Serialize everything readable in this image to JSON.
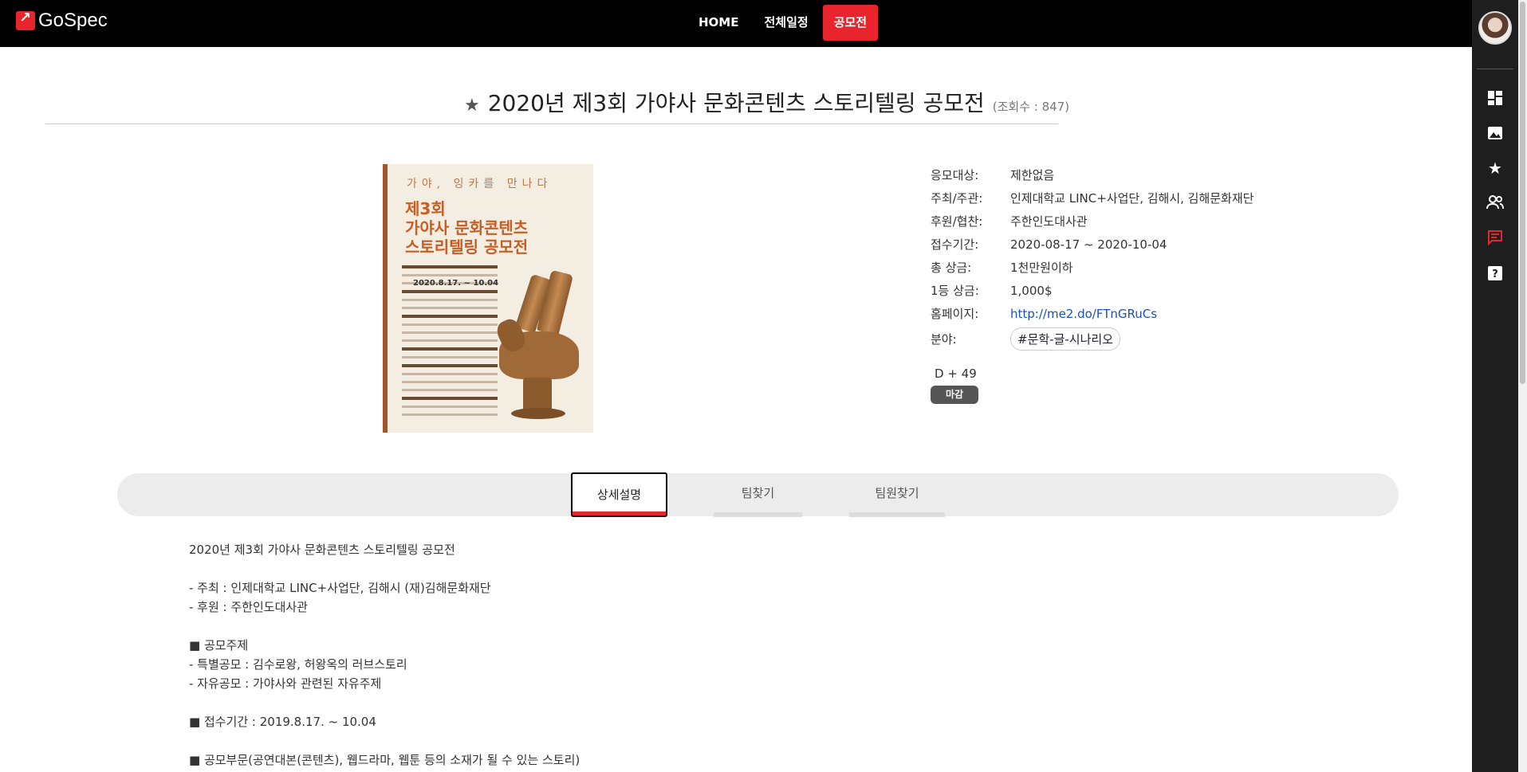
{
  "app": {
    "logo": "GoSpec"
  },
  "nav": {
    "items": [
      "HOME",
      "전체일정",
      "공모전"
    ],
    "active": "공모전"
  },
  "page": {
    "title": "2020년 제3회 가야사 문화콘텐츠 스토리텔링 공모전",
    "views": "(조회수 : 847)"
  },
  "poster": {
    "headline": "가야, 잉카를 만나다",
    "title_line1": "제3회",
    "title_line2": "가야사 문화콘텐츠",
    "title_line3": "스토리텔링 공모전",
    "date": "2020.8.17. ~ 10.04"
  },
  "info": [
    {
      "label": "응모대상:",
      "value": "제한없음"
    },
    {
      "label": "주최/주관:",
      "value": "인제대학교 LINC+사업단, 김해시, 김해문화재단"
    },
    {
      "label": "후원/협찬:",
      "value": "주한인도대사관"
    },
    {
      "label": "접수기간:",
      "value": "2020-08-17 ~ 2020-10-04"
    },
    {
      "label": "총 상금:",
      "value": "1천만원이하"
    },
    {
      "label": "1등 상금:",
      "value": "1,000$"
    },
    {
      "label": "홈페이지:",
      "value": "http://me2.do/FTnGRuCs"
    },
    {
      "label": "분야:",
      "value": "#문학-글-시나리오"
    }
  ],
  "status": {
    "dday": "D + 49",
    "badge": "마감"
  },
  "tabs": [
    "상세설명",
    "팀찾기",
    "팀원찾기"
  ],
  "description": [
    "2020년 제3회 가야사 문화콘텐츠 스토리텔링 공모전",
    "",
    "- 주최 : 인제대학교 LINC+사업단, 김해시 (재)김해문화재단",
    "- 후원 : 주한인도대사관",
    "",
    "■ 공모주제",
    "- 특별공모 : 김수로왕, 허왕옥의 러브스토리",
    "- 자유공모 : 가야사와 관련된 자유주제",
    "",
    "■ 접수기간 : 2019.8.17. ~ 10.04",
    "",
    "■ 공모부문(공연대본(콘텐츠), 웹드라마, 웹툰 등의 소재가 될 수 있는 스토리)"
  ],
  "sidebar_icons": [
    "dashboard-icon",
    "image-icon",
    "star-icon",
    "people-icon",
    "chat-icon",
    "help-icon"
  ],
  "colors": {
    "accent": "#e8242c",
    "topbar": "#000000",
    "sidebar": "#1e1e1e",
    "link": "#1a4fbf"
  }
}
